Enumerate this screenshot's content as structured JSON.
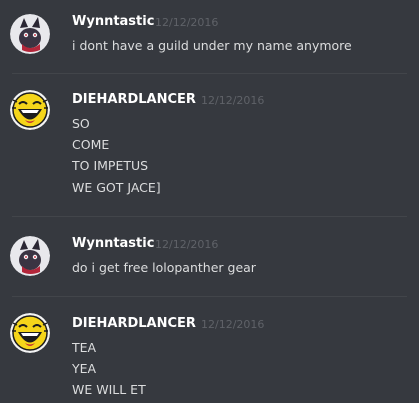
{
  "messages": [
    {
      "username": "Wynntastic",
      "timestamp": "12/12/2016",
      "avatar": "fox-avatar-icon",
      "lines": [
        "i dont have a guild under my name anymore"
      ]
    },
    {
      "username": "DIEHARDLANCER",
      "timestamp": "12/12/2016",
      "avatar": "laughing-face-avatar-icon",
      "lines": [
        "SO",
        "COME",
        "TO IMPETUS",
        "WE GOT JACE]"
      ]
    },
    {
      "username": "Wynntastic",
      "timestamp": "12/12/2016",
      "avatar": "fox-avatar-icon",
      "lines": [
        "do i get free lolopanther gear"
      ]
    },
    {
      "username": "DIEHARDLANCER",
      "timestamp": "12/12/2016",
      "avatar": "laughing-face-avatar-icon",
      "lines": [
        "TEA",
        "YEA",
        "WE WILL ET"
      ]
    }
  ],
  "colors": {
    "background": "#36393f",
    "username": "#ffffff",
    "message_text": "#dcddde",
    "timestamp": "#5f6268",
    "divider": "#42454a"
  }
}
